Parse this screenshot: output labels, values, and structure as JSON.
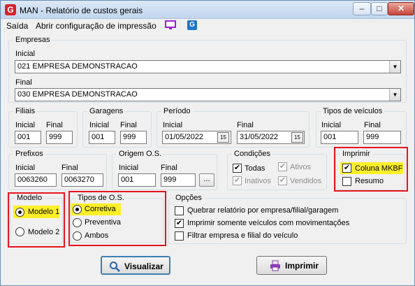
{
  "window": {
    "app_icon_letter": "G",
    "title": "MAN -  Relatório de custos gerais",
    "controls": {
      "minimize": "–",
      "maximize": "□",
      "close": "✕"
    }
  },
  "menu": {
    "items": [
      "Saída",
      "Abrir configuração de impressão"
    ],
    "icons": [
      "monitor-icon",
      "g-logo-icon"
    ],
    "icon_letter": "G"
  },
  "empresas": {
    "title": "Empresas",
    "inicial_label": "Inicial",
    "inicial_value": "021 EMPRESA DEMONSTRACAO",
    "final_label": "Final",
    "final_value": "030 EMPRESA DEMONSTRACAO"
  },
  "filiais": {
    "title": "Filiais",
    "inicial_label": "Inicial",
    "inicial": "001",
    "final_label": "Final",
    "final": "999"
  },
  "garagens": {
    "title": "Garagens",
    "inicial_label": "Inicial",
    "inicial": "001",
    "final_label": "Final",
    "final": "999"
  },
  "periodo": {
    "title": "Período",
    "inicial_label": "Inicial",
    "inicial": "01/05/2022",
    "final_label": "Final",
    "final": "31/05/2022",
    "cal_icon": "15"
  },
  "tipos_veiculos": {
    "title": "Tipos de veículos",
    "inicial_label": "Inicial",
    "inicial": "001",
    "final_label": "Final",
    "final": "999"
  },
  "prefixos": {
    "title": "Prefixos",
    "inicial_label": "Inicial",
    "inicial": "0063260",
    "final_label": "Final",
    "final": "0063270"
  },
  "origem_os": {
    "title": "Origem O.S.",
    "inicial_label": "Inicial",
    "inicial": "001",
    "final_label": "Final",
    "final": "999",
    "lookup": "..."
  },
  "condicoes": {
    "title": "Condições",
    "todas": "Todas",
    "ativos": "Ativos",
    "inativos": "Inativos",
    "vendidos": "Vendidos"
  },
  "imprimir": {
    "title": "Imprimir",
    "coluna_mkbf": "Coluna MKBF",
    "resumo": "Resumo"
  },
  "modelo": {
    "title": "Modelo",
    "modelo1": "Modelo 1",
    "modelo2": "Modelo 2",
    "selected": "Modelo 1"
  },
  "tipos_os": {
    "title": "Tipos de O.S.",
    "corretiva": "Corretiva",
    "preventiva": "Preventiva",
    "ambos": "Ambos",
    "selected": "Corretiva"
  },
  "opcoes": {
    "title": "Opções",
    "items": [
      {
        "label": "Quebrar relatório por empresa/filial/garagem",
        "checked": false
      },
      {
        "label": "Imprimir somente veículos com movimentações",
        "checked": true
      },
      {
        "label": "Filtrar empresa e filial do veículo",
        "checked": false
      }
    ]
  },
  "buttons": {
    "visualizar": "Visualizar",
    "imprimir": "Imprimir"
  },
  "colors": {
    "highlight": "#ffef28",
    "annotation_red": "#e6141e",
    "accent_blue": "#3c7fb1"
  }
}
